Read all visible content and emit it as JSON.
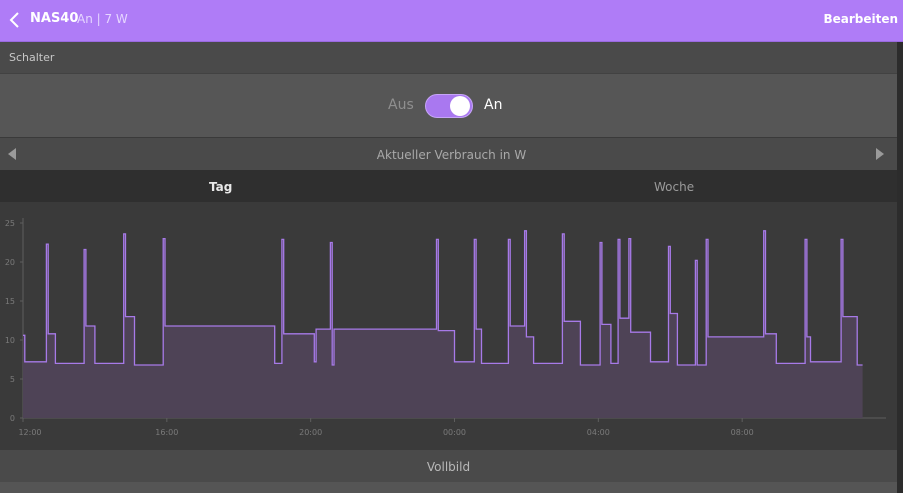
{
  "header": {
    "title": "NAS40",
    "status": "An | 7 W",
    "edit_label": "Bearbeiten"
  },
  "section": {
    "label": "Schalter"
  },
  "switch": {
    "off_label": "Aus",
    "on_label": "An",
    "state": "on"
  },
  "nav": {
    "label": "Aktueller Verbrauch in W"
  },
  "tabs": [
    {
      "label": "Tag",
      "active": true
    },
    {
      "label": "Woche",
      "active": false
    }
  ],
  "fullscreen_label": "Vollbild",
  "colors": {
    "accent": "#af7cf7",
    "line": "#a77ae8",
    "fill": "#4e4356"
  },
  "chart_data": {
    "type": "area",
    "ylim": [
      0,
      25
    ],
    "yticks": [
      "0",
      "5",
      "10",
      "15",
      "20",
      "25"
    ],
    "xlim": [
      0,
      24
    ],
    "xticks": [
      {
        "label": "12:00",
        "hour": 0
      },
      {
        "label": "16:00",
        "hour": 4
      },
      {
        "label": "20:00",
        "hour": 8
      },
      {
        "label": "00:00",
        "hour": 12
      },
      {
        "label": "04:00",
        "hour": 16
      },
      {
        "label": "08:00",
        "hour": 20
      }
    ],
    "points": [
      [
        0.0,
        10.6
      ],
      [
        0.05,
        10.6
      ],
      [
        0.05,
        7.2
      ],
      [
        0.65,
        7.2
      ],
      [
        0.65,
        22.3
      ],
      [
        0.7,
        22.3
      ],
      [
        0.7,
        10.8
      ],
      [
        0.9,
        10.8
      ],
      [
        0.9,
        7.0
      ],
      [
        1.7,
        7.0
      ],
      [
        1.7,
        21.6
      ],
      [
        1.75,
        21.6
      ],
      [
        1.75,
        11.8
      ],
      [
        2.0,
        11.8
      ],
      [
        2.0,
        7.0
      ],
      [
        2.8,
        7.0
      ],
      [
        2.8,
        23.6
      ],
      [
        2.85,
        23.6
      ],
      [
        2.85,
        13.0
      ],
      [
        3.1,
        13.0
      ],
      [
        3.1,
        6.8
      ],
      [
        3.9,
        6.8
      ],
      [
        3.9,
        23.0
      ],
      [
        3.95,
        23.0
      ],
      [
        3.95,
        11.8
      ],
      [
        7.0,
        11.8
      ],
      [
        7.0,
        7.0
      ],
      [
        7.2,
        7.0
      ],
      [
        7.2,
        22.9
      ],
      [
        7.25,
        22.9
      ],
      [
        7.25,
        10.8
      ],
      [
        8.1,
        10.8
      ],
      [
        8.1,
        7.2
      ],
      [
        8.15,
        7.2
      ],
      [
        8.15,
        11.4
      ],
      [
        8.55,
        11.4
      ],
      [
        8.55,
        22.5
      ],
      [
        8.6,
        22.5
      ],
      [
        8.6,
        6.8
      ],
      [
        8.65,
        6.8
      ],
      [
        8.65,
        11.4
      ],
      [
        11.5,
        11.4
      ],
      [
        11.5,
        22.9
      ],
      [
        11.55,
        22.9
      ],
      [
        11.55,
        11.2
      ],
      [
        12.0,
        11.2
      ],
      [
        12.0,
        7.2
      ],
      [
        12.55,
        7.2
      ],
      [
        12.55,
        22.9
      ],
      [
        12.6,
        22.9
      ],
      [
        12.6,
        11.4
      ],
      [
        12.75,
        11.4
      ],
      [
        12.75,
        7.0
      ],
      [
        13.5,
        7.0
      ],
      [
        13.5,
        22.9
      ],
      [
        13.55,
        22.9
      ],
      [
        13.55,
        11.8
      ],
      [
        13.95,
        11.8
      ],
      [
        13.95,
        24.0
      ],
      [
        14.0,
        24.0
      ],
      [
        14.0,
        10.4
      ],
      [
        14.2,
        10.4
      ],
      [
        14.2,
        7.0
      ],
      [
        15.0,
        7.0
      ],
      [
        15.0,
        23.6
      ],
      [
        15.05,
        23.6
      ],
      [
        15.05,
        12.4
      ],
      [
        15.5,
        12.4
      ],
      [
        15.5,
        6.8
      ],
      [
        16.05,
        6.8
      ],
      [
        16.05,
        22.5
      ],
      [
        16.1,
        22.5
      ],
      [
        16.1,
        12.0
      ],
      [
        16.35,
        12.0
      ],
      [
        16.35,
        7.0
      ],
      [
        16.55,
        7.0
      ],
      [
        16.55,
        22.9
      ],
      [
        16.6,
        22.9
      ],
      [
        16.6,
        12.8
      ],
      [
        16.85,
        12.8
      ],
      [
        16.85,
        23.0
      ],
      [
        16.9,
        23.0
      ],
      [
        16.9,
        11.0
      ],
      [
        17.45,
        11.0
      ],
      [
        17.45,
        7.2
      ],
      [
        17.95,
        7.2
      ],
      [
        17.95,
        22.0
      ],
      [
        18.0,
        22.0
      ],
      [
        18.0,
        13.4
      ],
      [
        18.2,
        13.4
      ],
      [
        18.2,
        6.8
      ],
      [
        18.7,
        6.8
      ],
      [
        18.7,
        20.2
      ],
      [
        18.75,
        20.2
      ],
      [
        18.75,
        6.8
      ],
      [
        19.0,
        6.8
      ],
      [
        19.0,
        22.9
      ],
      [
        19.05,
        22.9
      ],
      [
        19.05,
        10.4
      ],
      [
        20.6,
        10.4
      ],
      [
        20.6,
        24.0
      ],
      [
        20.65,
        24.0
      ],
      [
        20.65,
        10.8
      ],
      [
        20.95,
        10.8
      ],
      [
        20.95,
        7.0
      ],
      [
        21.75,
        7.0
      ],
      [
        21.75,
        22.9
      ],
      [
        21.8,
        22.9
      ],
      [
        21.8,
        10.4
      ],
      [
        21.9,
        10.4
      ],
      [
        21.9,
        7.2
      ],
      [
        22.75,
        7.2
      ],
      [
        22.75,
        22.9
      ],
      [
        22.8,
        22.9
      ],
      [
        22.8,
        13.0
      ],
      [
        23.2,
        13.0
      ],
      [
        23.2,
        6.8
      ],
      [
        23.35,
        6.8
      ]
    ]
  }
}
